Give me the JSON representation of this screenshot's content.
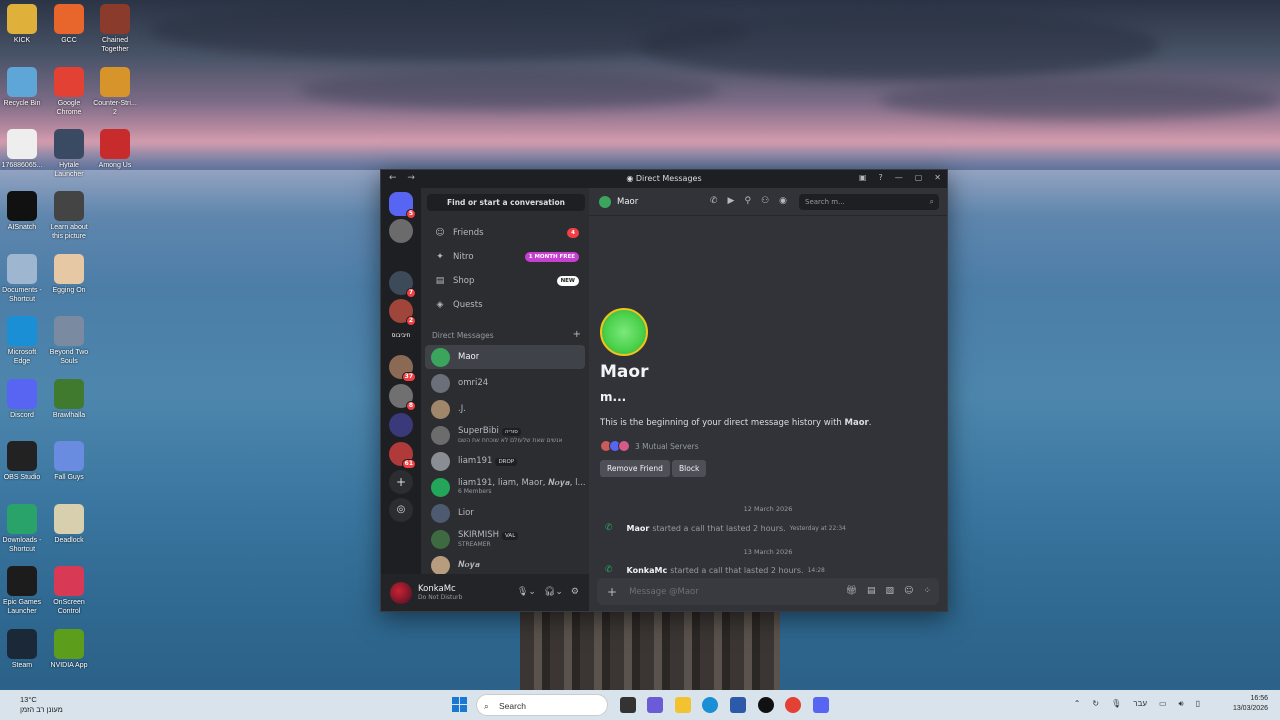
{
  "desktop": {
    "icons": [
      {
        "label": "KICK",
        "icon": "folder-icon",
        "color": "#e0b13a"
      },
      {
        "label": "GCC",
        "icon": "gcc-icon",
        "color": "#e8662b"
      },
      {
        "label": "Chained\nTogether",
        "icon": "chained-together-icon",
        "color": "#8a3b2b"
      },
      {
        "label": "Recycle Bin",
        "icon": "recycle-bin-icon",
        "color": "#5fa6d8"
      },
      {
        "label": "Google\nChrome",
        "icon": "chrome-icon",
        "color": "#e34133"
      },
      {
        "label": "Counter-Stri...\n2",
        "icon": "counter-strike-icon",
        "color": "#d6942a"
      },
      {
        "label": "176886065...",
        "icon": "file-icon",
        "color": "#eeeeee"
      },
      {
        "label": "Hytale\nLauncher",
        "icon": "hytale-icon",
        "color": "#3a4a63"
      },
      {
        "label": "Among Us",
        "icon": "among-us-icon",
        "color": "#c82b2b"
      },
      {
        "label": "AISnatch",
        "icon": "aisnatch-icon",
        "color": "#111111"
      },
      {
        "label": "Learn about\nthis picture",
        "icon": "learn-picture-icon",
        "color": "#444444"
      },
      {
        "label": "Documents -\nShortcut",
        "icon": "documents-icon",
        "color": "#9fb6d0"
      },
      {
        "label": "Egging On",
        "icon": "egging-on-icon",
        "color": "#e6c8a5"
      },
      {
        "label": "Microsoft\nEdge",
        "icon": "edge-icon",
        "color": "#1a8fd6"
      },
      {
        "label": "Beyond Two\nSouls",
        "icon": "beyond-two-souls-icon",
        "color": "#7a8aa0"
      },
      {
        "label": "Discord",
        "icon": "discord-icon",
        "color": "#5865f2"
      },
      {
        "label": "Brawlhalla",
        "icon": "brawlhalla-icon",
        "color": "#3f7a2e"
      },
      {
        "label": "OBS Studio",
        "icon": "obs-icon",
        "color": "#222222"
      },
      {
        "label": "Fall Guys",
        "icon": "fall-guys-icon",
        "color": "#6a8ce0"
      },
      {
        "label": "Downloads -\nShortcut",
        "icon": "downloads-icon",
        "color": "#2aa36a"
      },
      {
        "label": "Deadlock",
        "icon": "deadlock-icon",
        "color": "#d8cfae"
      },
      {
        "label": "Epic Games\nLauncher",
        "icon": "epic-games-icon",
        "color": "#1c1c1c"
      },
      {
        "label": "OnScreen\nControl",
        "icon": "onscreen-control-icon",
        "color": "#d83a55"
      },
      {
        "label": "Steam",
        "icon": "steam-icon",
        "color": "#1b2838"
      },
      {
        "label": "NVIDIA App",
        "icon": "nvidia-icon",
        "color": "#5c9e1c"
      }
    ]
  },
  "window": {
    "title": "Direct Messages",
    "guild_badges": [
      "5",
      "",
      "7",
      "2",
      "",
      "37",
      "8",
      "",
      "61"
    ],
    "guild_text_logo": "חיביבוס"
  },
  "sidebar": {
    "find_placeholder": "Find or start a conversation",
    "nav": [
      {
        "label": "Friends",
        "icon": "friends-icon",
        "badge": "4"
      },
      {
        "label": "Nitro",
        "icon": "nitro-icon",
        "badge": "1 MONTH FREE"
      },
      {
        "label": "Shop",
        "icon": "shop-icon",
        "badge": "NEW"
      },
      {
        "label": "Quests",
        "icon": "quests-icon",
        "badge": ""
      }
    ],
    "dm_header": "Direct Messages",
    "dms": [
      {
        "name": "Maor",
        "sub": "",
        "tag": "",
        "color": "#3ba55d"
      },
      {
        "name": "omri24",
        "sub": "",
        "tag": "",
        "color": "#6b6f7a"
      },
      {
        "name": ".J.",
        "sub": "",
        "tag": "",
        "color": "#a0876b"
      },
      {
        "name": "SuperBibi",
        "sub": "אנשים שאת שלעולם לא שוכחת את השם",
        "tag": "סוריה",
        "color": "#6c6c6c"
      },
      {
        "name": "liam191",
        "sub": "",
        "tag": "DROP",
        "color": "#8a8d94"
      },
      {
        "name": "liam191, liam, Maor, 𝑵𝒐𝒚𝒂, l...",
        "sub": "6 Members",
        "tag": "",
        "color": "#23a55a"
      },
      {
        "name": "Lior",
        "sub": "",
        "tag": "",
        "color": "#4d5a70"
      },
      {
        "name": "SKIRMISH",
        "sub": "STREAMER",
        "tag": "VAL",
        "color": "#3d6a40"
      },
      {
        "name": "𝑵𝒐𝒚𝒂",
        "sub": "",
        "tag": "",
        "color": "#b89c80"
      }
    ]
  },
  "user": {
    "name": "KonkaMc",
    "status": "Do Not Disturb"
  },
  "chat": {
    "recipient": "Maor",
    "search_placeholder": "Search m...",
    "intro_name": "Maor",
    "intro_username": "m...",
    "intro_text_pre": "This is the beginning of your direct message history with ",
    "intro_text_name": "Maor",
    "intro_text_post": ".",
    "mutual": "3 Mutual Servers",
    "remove_friend": "Remove Friend",
    "block": "Block",
    "dates": [
      "12 March 2026",
      "13 March 2026"
    ],
    "calls": [
      {
        "user": "Maor",
        "text": "started a call that lasted 2 hours.",
        "time": "Yesterday at 22:34"
      },
      {
        "user": "KonkaMc",
        "text": "started a call that lasted 2 hours.",
        "time": "14:28"
      }
    ],
    "composer_placeholder": "Message @Maor"
  },
  "taskbar": {
    "temp": "13°C",
    "weather": "מעונן רב הזמן",
    "search": "Search",
    "lang": "עבר",
    "time": "16:56",
    "date": "13/03/2026"
  }
}
